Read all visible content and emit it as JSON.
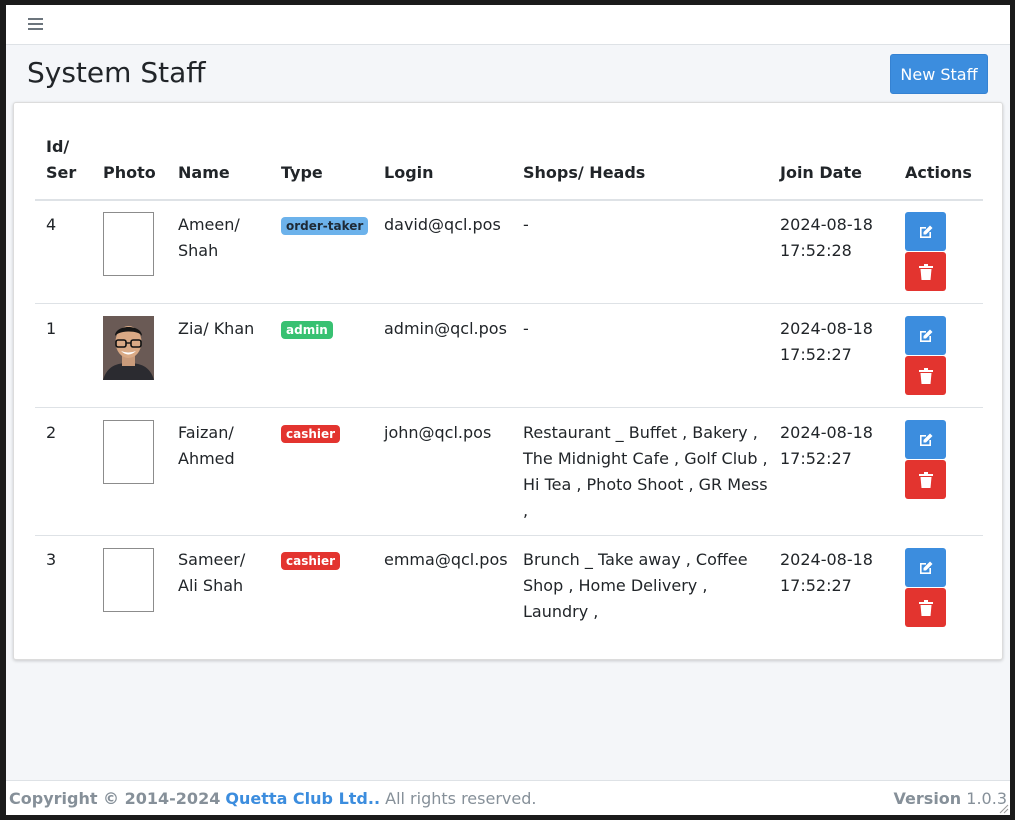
{
  "header": {
    "menu_icon": "hamburger-icon"
  },
  "page": {
    "title": "System Staff",
    "new_button": "New Staff"
  },
  "table": {
    "columns": {
      "id_line1": "Id/",
      "id_line2": "Ser",
      "photo": "Photo",
      "name": "Name",
      "type": "Type",
      "login": "Login",
      "shops": "Shops/ Heads",
      "join_date": "Join Date",
      "actions": "Actions"
    },
    "rows": [
      {
        "id": "4",
        "name_1": "Ameen/",
        "name_2": "Shah",
        "type": "order-taker",
        "login": "david@qcl.pos",
        "shops": [
          "-"
        ],
        "date": "2024-08-18",
        "time": "17:52:28",
        "photo": "empty"
      },
      {
        "id": "1",
        "name_1": "Zia/ Khan",
        "name_2": "",
        "type": "admin",
        "login": "admin@qcl.pos",
        "shops": [
          "-"
        ],
        "date": "2024-08-18",
        "time": "17:52:27",
        "photo": "avatar"
      },
      {
        "id": "2",
        "name_1": "Faizan/",
        "name_2": "Ahmed",
        "type": "cashier",
        "login": "john@qcl.pos",
        "shops": [
          "Restaurant _ Buffet , Bakery ,",
          "The Midnight Cafe , Golf Club ,",
          "Hi Tea , Photo Shoot , GR Mess",
          ","
        ],
        "date": "2024-08-18",
        "time": "17:52:27",
        "photo": "empty"
      },
      {
        "id": "3",
        "name_1": "Sameer/",
        "name_2": "Ali Shah",
        "type": "cashier",
        "login": "emma@qcl.pos",
        "shops": [
          "Brunch _ Take away , Coffee",
          "Shop , Home Delivery ,",
          "Laundry ,"
        ],
        "date": "2024-08-18",
        "time": "17:52:27",
        "photo": "empty"
      }
    ]
  },
  "footer": {
    "copyright": "Copyright © 2014-2024",
    "company": "Quetta Club Ltd..",
    "rights": "All rights reserved.",
    "version_label": "Version",
    "version": "1.0.3"
  },
  "colors": {
    "primary": "#3c8dde",
    "danger": "#e3342f",
    "success": "#38c172",
    "info": "#6cb2eb"
  }
}
